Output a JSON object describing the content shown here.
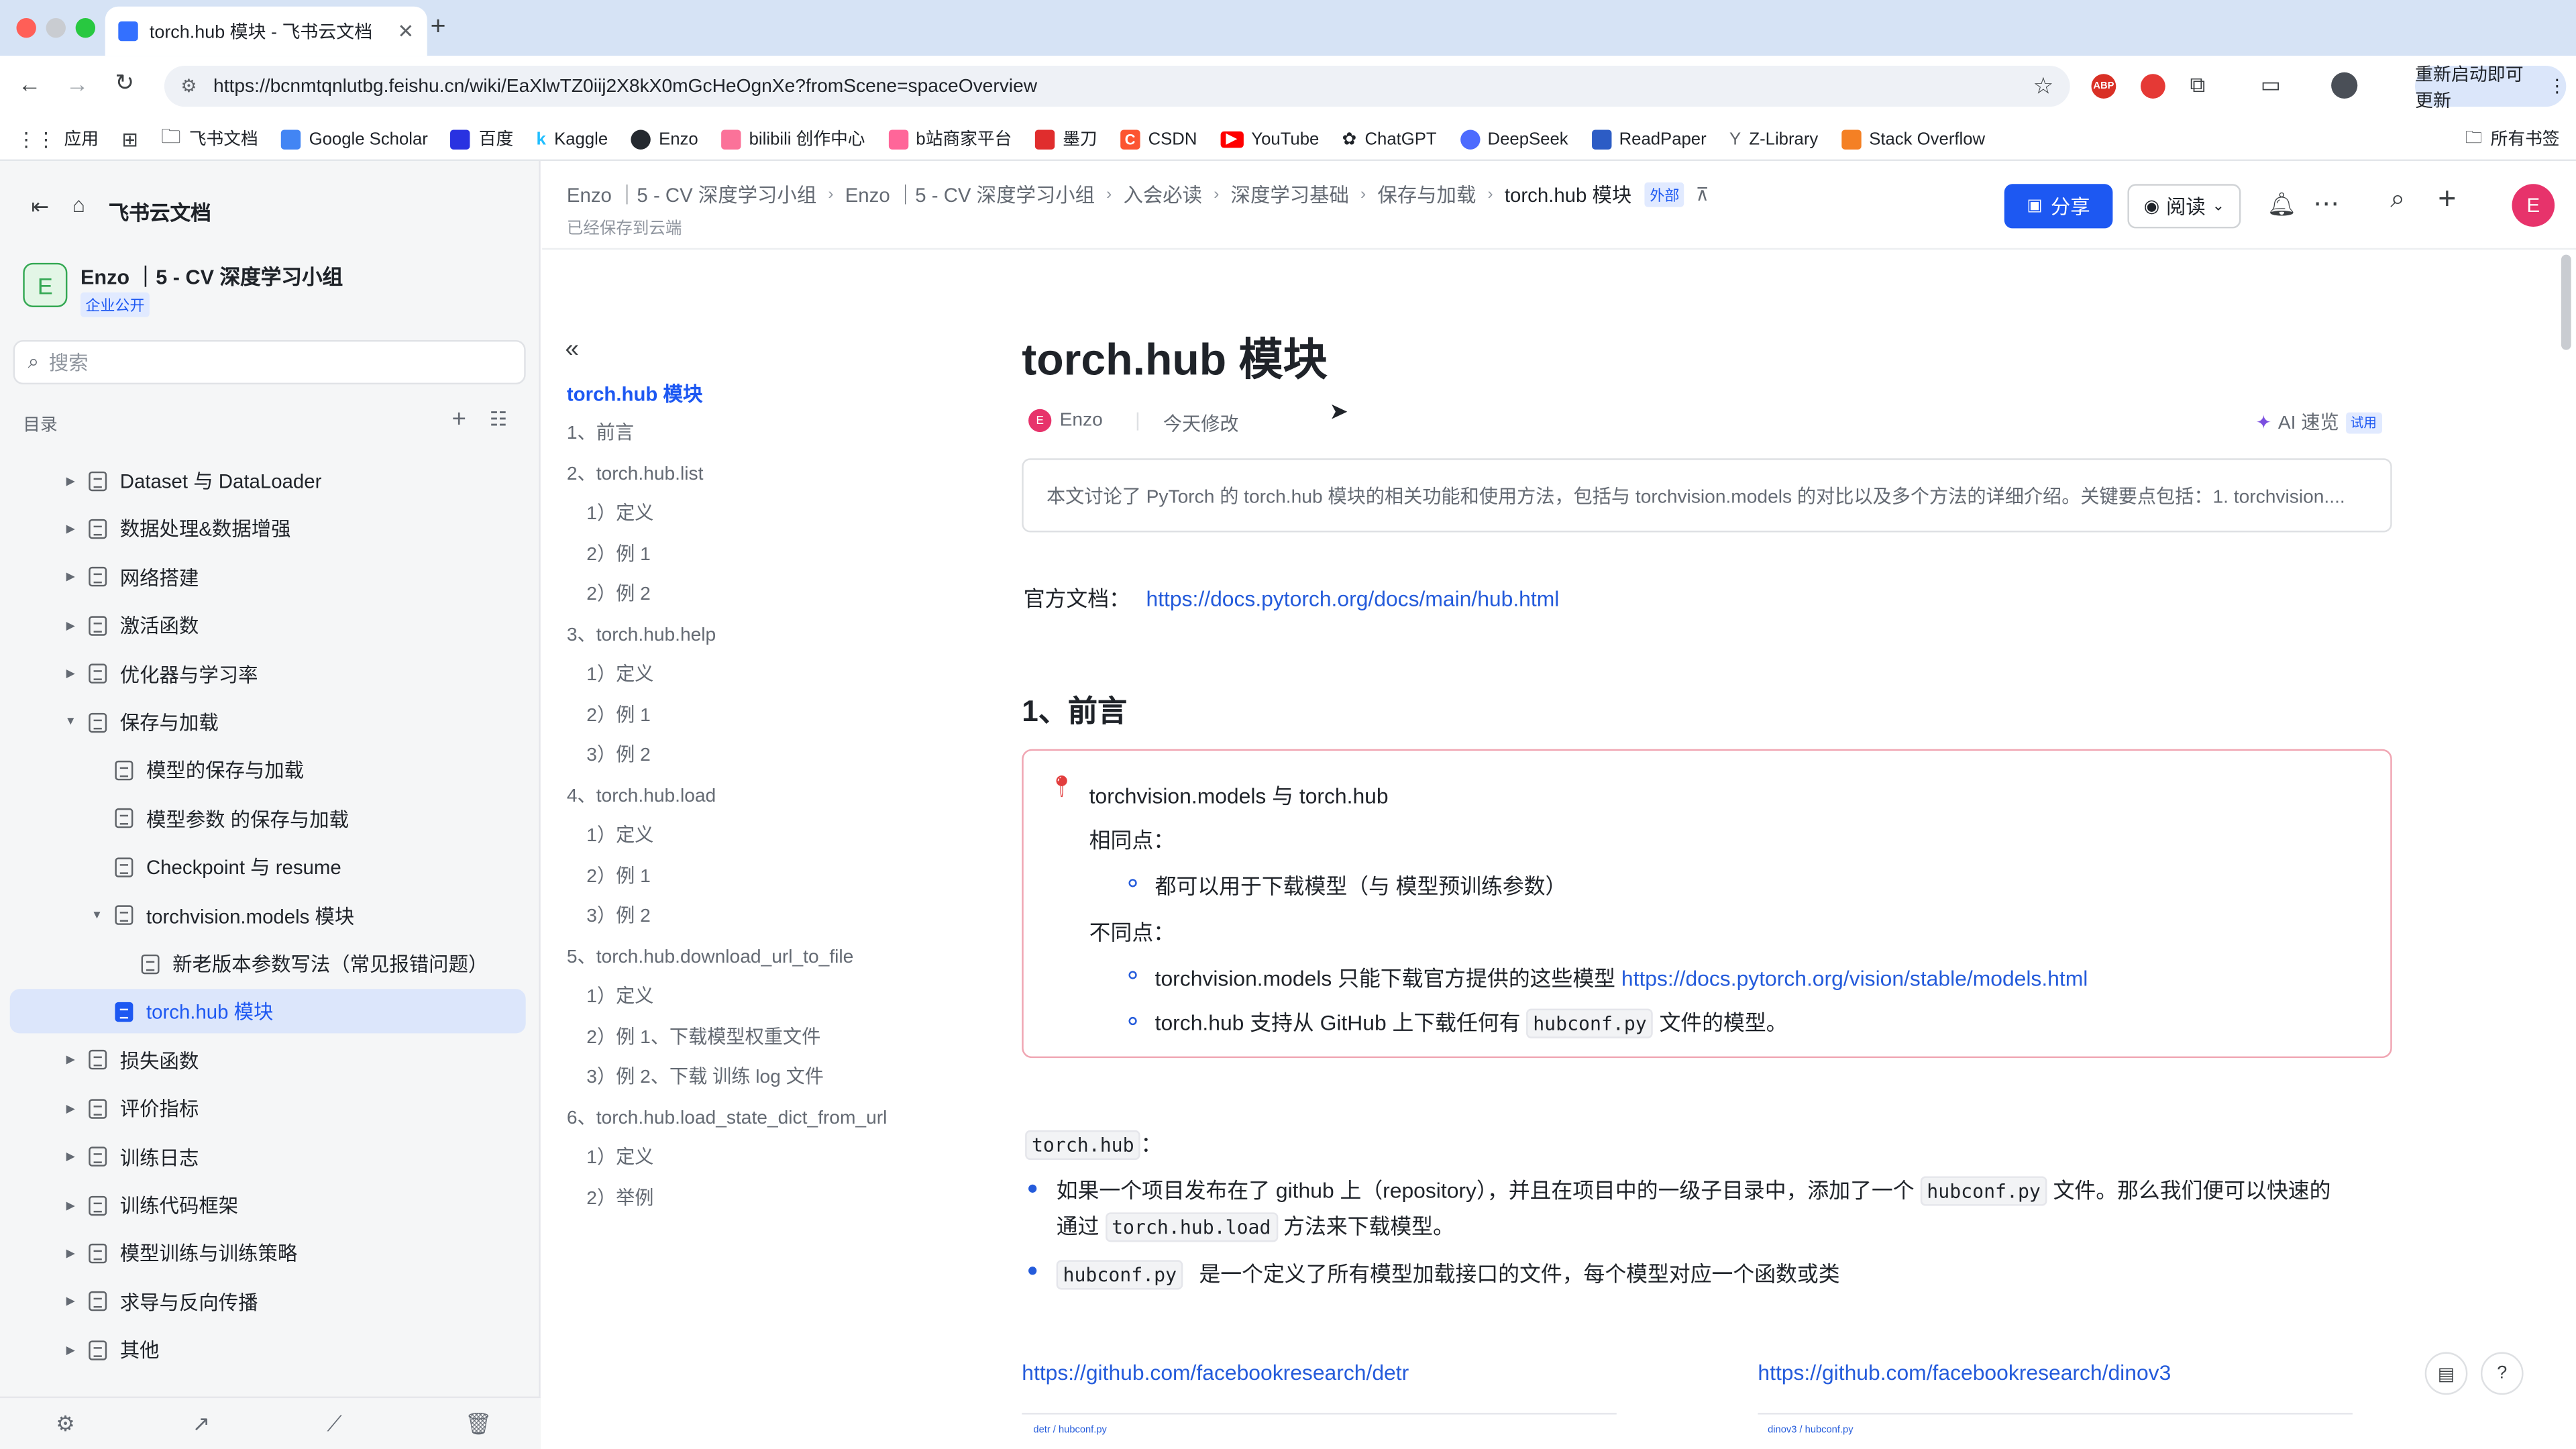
{
  "browser": {
    "tab_title": "torch.hub 模块 - 飞书云文档",
    "url": "https://bcnmtqnlutbg.feishu.cn/wiki/EaXlwTZ0iij2X8kX0mGcHeOgnXe?fromScene=spaceOverview",
    "relaunch_label": "重新启动即可更新",
    "bookmarks": [
      "应用",
      "飞书文档",
      "Google Scholar",
      "百度",
      "Kaggle",
      "Enzo",
      "bilibili 创作中心",
      "b站商家平台",
      "墨刀",
      "CSDN",
      "YouTube",
      "ChatGPT",
      "DeepSeek",
      "ReadPaper",
      "Z-Library",
      "Stack Overflow"
    ],
    "all_bookmarks": "所有书签"
  },
  "sidebar": {
    "app_name": "飞书云文档",
    "space_avatar": "E",
    "space_name": "Enzo ｜5 - CV 深度学习小组",
    "space_badge": "企业公开",
    "search_placeholder": "搜索",
    "toc_label": "目录",
    "items": [
      {
        "label": "Dataset 与 DataLoader",
        "level": 0,
        "expand": "collapsed"
      },
      {
        "label": "数据处理&数据增强",
        "level": 0,
        "expand": "collapsed"
      },
      {
        "label": "网络搭建",
        "level": 0,
        "expand": "collapsed"
      },
      {
        "label": "激活函数",
        "level": 0,
        "expand": "collapsed"
      },
      {
        "label": "优化器与学习率",
        "level": 0,
        "expand": "collapsed"
      },
      {
        "label": "保存与加载",
        "level": 0,
        "expand": "expanded"
      },
      {
        "label": "模型的保存与加载",
        "level": 1,
        "expand": "none"
      },
      {
        "label": "模型参数 的保存与加载",
        "level": 1,
        "expand": "none"
      },
      {
        "label": "Checkpoint 与 resume",
        "level": 1,
        "expand": "none"
      },
      {
        "label": "torchvision.models 模块",
        "level": 1,
        "expand": "expanded"
      },
      {
        "label": "新老版本参数写法（常见报错问题）",
        "level": 2,
        "expand": "none"
      },
      {
        "label": "torch.hub 模块",
        "level": 1,
        "expand": "none",
        "active": true
      },
      {
        "label": "损失函数",
        "level": 0,
        "expand": "collapsed"
      },
      {
        "label": "评价指标",
        "level": 0,
        "expand": "collapsed"
      },
      {
        "label": "训练日志",
        "level": 0,
        "expand": "collapsed"
      },
      {
        "label": "训练代码框架",
        "level": 0,
        "expand": "collapsed"
      },
      {
        "label": "模型训练与训练策略",
        "level": 0,
        "expand": "collapsed"
      },
      {
        "label": "求导与反向传播",
        "level": 0,
        "expand": "collapsed"
      },
      {
        "label": "其他",
        "level": 0,
        "expand": "collapsed"
      }
    ]
  },
  "header": {
    "breadcrumbs": [
      "Enzo ｜5 - CV 深度学习小组",
      "Enzo ｜5 - CV 深度学习小组",
      "入会必读",
      "深度学习基础",
      "保存与加载",
      "torch.hub 模块"
    ],
    "external_badge": "外部",
    "saved_status": "已经保存到云端",
    "share_label": "分享",
    "read_label": "阅读",
    "avatar": "E"
  },
  "outline": {
    "title": "torch.hub 模块",
    "items": [
      {
        "label": "1、前言",
        "level": 1
      },
      {
        "label": "2、torch.hub.list",
        "level": 1
      },
      {
        "label": "1）定义",
        "level": 2
      },
      {
        "label": "2）例 1",
        "level": 2
      },
      {
        "label": "2）例 2",
        "level": 2
      },
      {
        "label": "3、torch.hub.help",
        "level": 1
      },
      {
        "label": "1）定义",
        "level": 2
      },
      {
        "label": "2）例 1",
        "level": 2
      },
      {
        "label": "3）例 2",
        "level": 2
      },
      {
        "label": "4、torch.hub.load",
        "level": 1
      },
      {
        "label": "1）定义",
        "level": 2
      },
      {
        "label": "2）例 1",
        "level": 2
      },
      {
        "label": "3）例 2",
        "level": 2
      },
      {
        "label": "5、torch.hub.download_url_to_file",
        "level": 1
      },
      {
        "label": "1）定义",
        "level": 2
      },
      {
        "label": "2）例 1、下载模型权重文件",
        "level": 2
      },
      {
        "label": "3）例 2、下载 训练 log 文件",
        "level": 2
      },
      {
        "label": "6、torch.hub.load_state_dict_from_url",
        "level": 1
      },
      {
        "label": "1）定义",
        "level": 2
      },
      {
        "label": "2）举例",
        "level": 2
      }
    ]
  },
  "doc": {
    "title": "torch.hub 模块",
    "author": "Enzo",
    "author_avatar": "E",
    "modified": "今天修改",
    "ai_label": "AI 速览",
    "ai_badge": "试用",
    "summary": "本文讨论了 PyTorch 的 torch.hub 模块的相关功能和使用方法，包括与 torchvision.models 的对比以及多个方法的详细介绍。关键要点包括：1. torchvision....",
    "official_label": "官方文档：",
    "official_url": "https://docs.pytorch.org/docs/main/hub.html",
    "h1": "1、前言",
    "callout": {
      "title": "torchvision.models 与 torch.hub",
      "same_label": "相同点：",
      "same_item": "都可以用于下载模型（与 模型预训练参数）",
      "diff_label": "不同点：",
      "diff_item1_text": "torchvision.models 只能下载官方提供的这些模型",
      "diff_item1_link": "https://docs.pytorch.org/vision/stable/models.html",
      "diff_item2_pre": "torch.hub 支持从 GitHub 上下载任何有",
      "diff_item2_code": "hubconf.py",
      "diff_item2_post": "文件的模型。"
    },
    "code_label": "torch.hub",
    "colon": "：",
    "b1_pre": "如果一个项目发布在了 github 上（repository），并且在项目中的一级子目录中，添加了一个",
    "b1_code": "hubconf.py",
    "b1_mid": "文件。那么我们便可以快速的",
    "b1_line2_pre": "通过",
    "b1_code2": "torch.hub.load",
    "b1_post": "方法来下载模型。",
    "b2_code": "hubconf.py",
    "b2_text": "是一个定义了所有模型加载接口的文件，每个模型对应一个函数或类",
    "link_left": "https://github.com/facebookresearch/detr",
    "link_right": "https://github.com/facebookresearch/dinov3",
    "thumb_left": "detr / hubconf.py",
    "thumb_right": "dinov3 / hubconf.py"
  }
}
